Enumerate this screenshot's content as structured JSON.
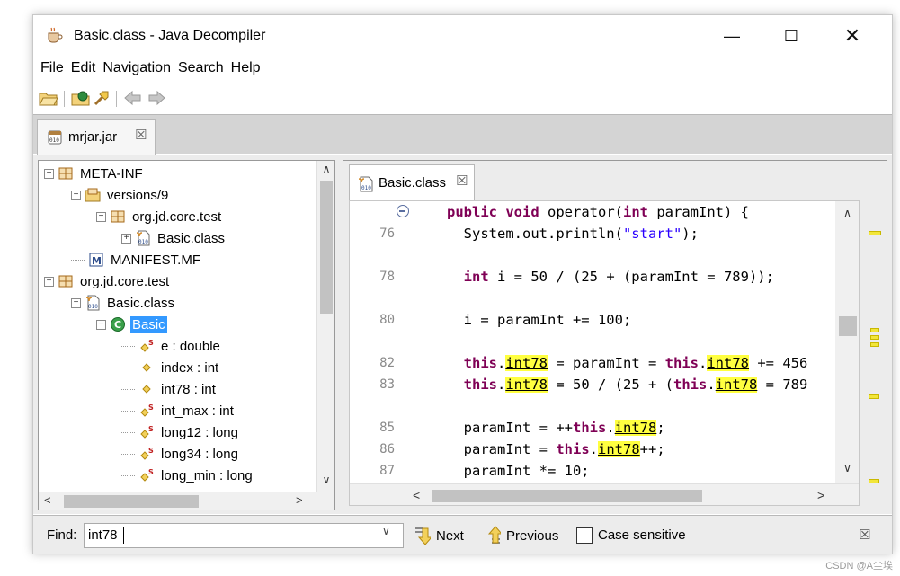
{
  "window": {
    "title": "Basic.class - Java Decompiler",
    "minimize": "—",
    "maximize": "☐",
    "close": "✕"
  },
  "menu": [
    "File",
    "Edit",
    "Navigation",
    "Search",
    "Help"
  ],
  "toolbar": {
    "icons": [
      "open-folder-icon",
      "open-type-icon",
      "search-type-icon",
      "back-arrow-icon",
      "forward-arrow-icon"
    ]
  },
  "jar_tab": {
    "label": "mrjar.jar",
    "close": "☒"
  },
  "tree": {
    "nodes": [
      {
        "label": "META-INF",
        "icon": "package-icon",
        "expander": "−"
      },
      {
        "label": "versions/9",
        "icon": "folder-icon",
        "expander": "−"
      },
      {
        "label": "org.jd.core.test",
        "icon": "package-icon",
        "expander": "−"
      },
      {
        "label": "Basic.class",
        "icon": "class-file-icon",
        "expander": "+"
      },
      {
        "label": "MANIFEST.MF",
        "icon": "manifest-icon",
        "expander": ""
      },
      {
        "label": "org.jd.core.test",
        "icon": "package-icon",
        "expander": "−"
      },
      {
        "label": "Basic.class",
        "icon": "class-file-icon",
        "expander": "−"
      },
      {
        "label": "Basic",
        "icon": "class-icon",
        "expander": "−",
        "selected": true
      },
      {
        "label": "e : double",
        "icon": "static-field-icon",
        "expander": ""
      },
      {
        "label": "index : int",
        "icon": "field-icon",
        "expander": ""
      },
      {
        "label": "int78 : int",
        "icon": "field-icon",
        "expander": ""
      },
      {
        "label": "int_max : int",
        "icon": "static-field-icon",
        "expander": ""
      },
      {
        "label": "long12 : long",
        "icon": "static-field-icon",
        "expander": ""
      },
      {
        "label": "long34 : long",
        "icon": "static-field-icon",
        "expander": ""
      },
      {
        "label": "long_min : long",
        "icon": "static-field-icon",
        "expander": ""
      }
    ]
  },
  "code_tab": {
    "label": "Basic.class",
    "close": "☒"
  },
  "code": {
    "lines": [
      {
        "num": "",
        "fold": true,
        "segments": [
          [
            "kw",
            "public"
          ],
          [
            "t",
            " "
          ],
          [
            "kw",
            "void"
          ],
          [
            "t",
            " operator("
          ],
          [
            "kw",
            "int"
          ],
          [
            "t",
            " paramInt) {"
          ]
        ]
      },
      {
        "num": "76",
        "segments": [
          [
            "t",
            "  System.out.println("
          ],
          [
            "str",
            "\"start\""
          ],
          [
            "t",
            ");"
          ]
        ]
      },
      {
        "num": "",
        "segments": []
      },
      {
        "num": "78",
        "segments": [
          [
            "t",
            "  "
          ],
          [
            "kw",
            "int"
          ],
          [
            "t",
            " i = 50 / (25 + (paramInt = 789));"
          ]
        ]
      },
      {
        "num": "",
        "segments": []
      },
      {
        "num": "80",
        "segments": [
          [
            "t",
            "  i = paramInt += 100;"
          ]
        ]
      },
      {
        "num": "",
        "segments": []
      },
      {
        "num": "82",
        "segments": [
          [
            "t",
            "  "
          ],
          [
            "kw",
            "this"
          ],
          [
            "t",
            "."
          ],
          [
            "hl",
            "int78"
          ],
          [
            "t",
            " = paramInt = "
          ],
          [
            "kw",
            "this"
          ],
          [
            "t",
            "."
          ],
          [
            "hl",
            "int78"
          ],
          [
            "t",
            " += 456"
          ]
        ]
      },
      {
        "num": "83",
        "segments": [
          [
            "t",
            "  "
          ],
          [
            "kw",
            "this"
          ],
          [
            "t",
            "."
          ],
          [
            "hl",
            "int78"
          ],
          [
            "t",
            " = 50 / (25 + ("
          ],
          [
            "kw",
            "this"
          ],
          [
            "t",
            "."
          ],
          [
            "hl",
            "int78"
          ],
          [
            "t",
            " = 789"
          ]
        ]
      },
      {
        "num": "",
        "segments": []
      },
      {
        "num": "85",
        "segments": [
          [
            "t",
            "  paramInt = ++"
          ],
          [
            "kw",
            "this"
          ],
          [
            "t",
            "."
          ],
          [
            "hl",
            "int78"
          ],
          [
            "t",
            ";"
          ]
        ]
      },
      {
        "num": "86",
        "segments": [
          [
            "t",
            "  paramInt = "
          ],
          [
            "kw",
            "this"
          ],
          [
            "t",
            "."
          ],
          [
            "hl",
            "int78"
          ],
          [
            "t",
            "++;"
          ]
        ]
      },
      {
        "num": "87",
        "segments": [
          [
            "t",
            "  paramInt *= 10;"
          ]
        ]
      }
    ]
  },
  "find": {
    "label": "Find:",
    "value": "int78",
    "next": "Next",
    "previous": "Previous",
    "case_sensitive": "Case sensitive",
    "case_checked": false,
    "close": "☒"
  },
  "watermark": "CSDN @A尘埃",
  "colors": {
    "keyword": "#7f0055",
    "string": "#2a00ff",
    "highlight": "#ffff40",
    "selection": "#3399ff"
  }
}
